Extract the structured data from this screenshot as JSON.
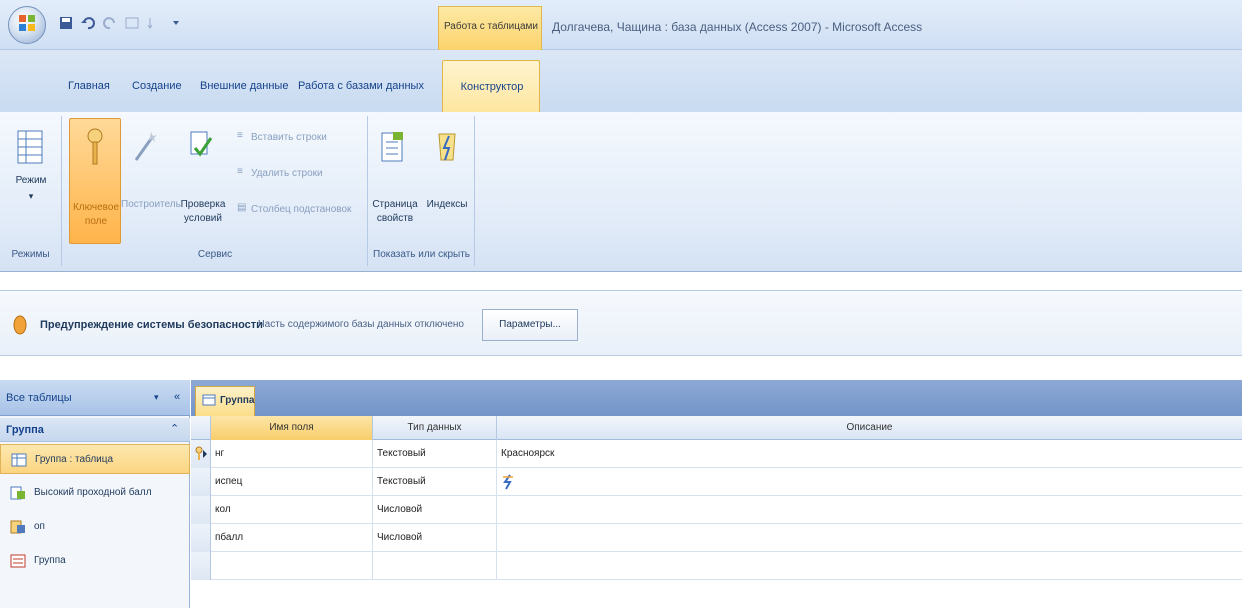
{
  "window": {
    "title": "Долгачева, Чащина : база данных (Access 2007) - Microsoft Access",
    "context_tab_group": "Работа с таблицами"
  },
  "tabs": [
    {
      "label": "Главная"
    },
    {
      "label": "Создание"
    },
    {
      "label": "Внешние данные"
    },
    {
      "label": "Работа с базами данных"
    },
    {
      "label": "Конструктор"
    }
  ],
  "ribbon": {
    "modes": {
      "label": "Режимы",
      "btn_mode": "Режим"
    },
    "service": {
      "label": "Сервис",
      "btn_key_line1": "Ключевое",
      "btn_key_line2": "поле",
      "btn_builder": "Построитель",
      "btn_check_line1": "Проверка",
      "btn_check_line2": "условий",
      "insert_rows": "Вставить строки",
      "delete_rows": "Удалить строки",
      "lookup_column": "Столбец подстановок"
    },
    "show_hide": {
      "label": "Показать или скрыть",
      "btn_props_line1": "Страница",
      "btn_props_line2": "свойств",
      "btn_indexes": "Индексы"
    }
  },
  "security": {
    "title": "Предупреждение системы безопасности",
    "text": "Часть содержимого базы данных отключено",
    "button": "Параметры..."
  },
  "nav": {
    "header": "Все таблицы",
    "group": "Группа",
    "items": [
      {
        "label": "Группа : таблица",
        "icon": "table-icon"
      },
      {
        "label": "Высокий проходной балл",
        "icon": "query-icon"
      },
      {
        "label": "оп",
        "icon": "query-icon"
      },
      {
        "label": "Группа",
        "icon": "form-icon"
      }
    ]
  },
  "document": {
    "tab_label": "Группа",
    "columns": [
      "Имя поля",
      "Тип данных",
      "Описание"
    ],
    "rows": [
      {
        "name": "нг",
        "type": "Текстовый",
        "desc": "Красноярск"
      },
      {
        "name": "испец",
        "type": "Текстовый",
        "desc": ""
      },
      {
        "name": "кол",
        "type": "Числовой",
        "desc": ""
      },
      {
        "name": "пбалл",
        "type": "Числовой",
        "desc": ""
      },
      {
        "name": "",
        "type": "",
        "desc": ""
      }
    ]
  },
  "colors": {
    "accent": "#fbd581",
    "ribbon": "#dbe7f6",
    "frame": "#7395c8"
  }
}
